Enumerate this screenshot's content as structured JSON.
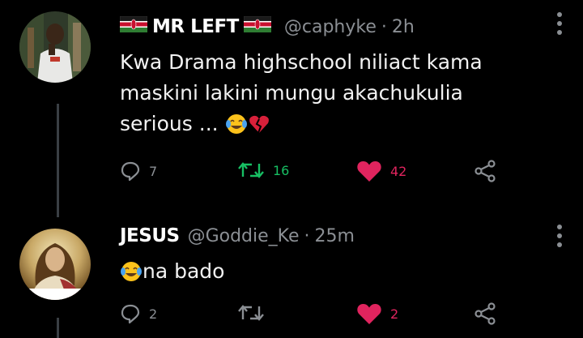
{
  "tweets": [
    {
      "name": "MR LEFT",
      "handle": "@caphyke",
      "separator": "·",
      "time": "2h",
      "text": "Kwa Drama highschool niliact kama maskini lakini mungu akachukulia serious ...",
      "emojis": [
        "face-with-tears-of-joy",
        "broken-heart"
      ],
      "replies": "7",
      "retweets": "16",
      "likes": "42"
    },
    {
      "name": "JESUS",
      "handle": "@Goddie_Ke",
      "separator": "·",
      "time": "25m",
      "text": "na bado",
      "emojis": [
        "face-with-tears-of-joy"
      ],
      "replies": "2",
      "retweets": "",
      "likes": "2"
    }
  ],
  "icons": {
    "reply": "reply-icon",
    "retweet": "retweet-icon",
    "like": "heart-icon",
    "share": "share-icon",
    "more": "more-vertical-icon",
    "flag": "kenya-flag-icon"
  },
  "colors": {
    "background": "#000000",
    "retweet": "#17bf63",
    "like": "#e0245e",
    "muted": "#8b8f94"
  }
}
